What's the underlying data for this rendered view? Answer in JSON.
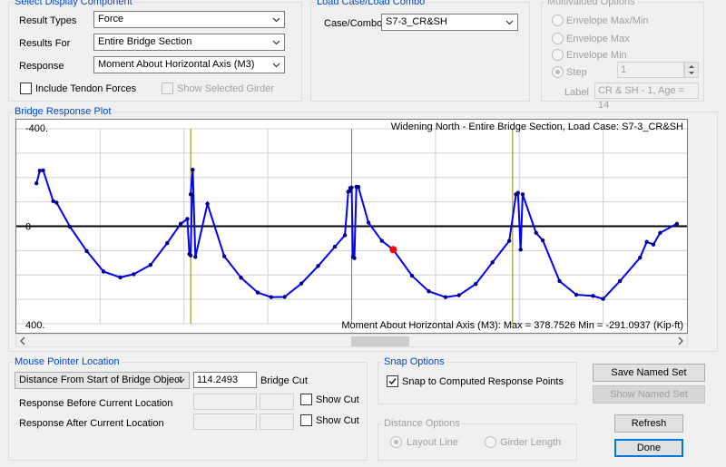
{
  "display": {
    "legend": "Select Display Component",
    "result_types_label": "Result Types",
    "result_types_value": "Force",
    "results_for_label": "Results For",
    "results_for_value": "Entire Bridge Section",
    "response_label": "Response",
    "response_value": "Moment About Horizontal Axis  (M3)",
    "include_tendon_label": "Include Tendon Forces",
    "show_selected_girder_label": "Show Selected Girder"
  },
  "load_case": {
    "legend": "Load Case/Load Combo",
    "case_label": "Case/Combo",
    "case_value": "S7-3_CR&SH"
  },
  "multivalued": {
    "legend": "Multivalued Options",
    "envelope_maxmin": "Envelope Max/Min",
    "envelope_max": "Envelope Max",
    "envelope_min": "Envelope Min",
    "step_label": "Step",
    "step_value": "1",
    "label_label": "Label",
    "label_value": "CR & SH  - 1, Age = 14"
  },
  "plot": {
    "legend": "Bridge Response Plot",
    "header_text": "Widening North - Entire Bridge Section,  Load Case: S7-3_CR&SH",
    "footer_text": "Moment About Horizontal Axis  (M3):  Max = 378.7526    Min = -291.0937  (Kip-ft)"
  },
  "chart_data": {
    "type": "line",
    "y_top_label": "-400.",
    "y_zero_label": "0",
    "y_bottom_label": "400.",
    "ylim": [
      -400,
      400
    ],
    "y_inverted": true,
    "grid": true,
    "line_color": "#0000ff",
    "marker_color": "#00008b",
    "zero_line_color": "#000000",
    "support_line_color": "#8b8b00",
    "cursor_color": "#ff0000",
    "supports_x_fraction": [
      0.26,
      0.5,
      0.74
    ],
    "cursor_point": {
      "x": 0.562,
      "y": 96
    },
    "series": [
      {
        "values": [
          [
            0.03,
            -176
          ],
          [
            0.035,
            -228
          ],
          [
            0.04,
            -229
          ],
          [
            0.055,
            -103
          ],
          [
            0.06,
            -97
          ],
          [
            0.08,
            2
          ],
          [
            0.105,
            102
          ],
          [
            0.13,
            186
          ],
          [
            0.155,
            210
          ],
          [
            0.175,
            197
          ],
          [
            0.2,
            159
          ],
          [
            0.225,
            69
          ],
          [
            0.245,
            -10
          ],
          [
            0.255,
            -30
          ],
          [
            0.258,
            114
          ],
          [
            0.26,
            120
          ],
          [
            0.262,
            -130
          ],
          [
            0.26,
            -131
          ],
          [
            0.263,
            -232
          ],
          [
            0.267,
            126
          ],
          [
            0.285,
            -92
          ],
          [
            0.31,
            123
          ],
          [
            0.335,
            211
          ],
          [
            0.36,
            272
          ],
          [
            0.38,
            291
          ],
          [
            0.4,
            290
          ],
          [
            0.425,
            235
          ],
          [
            0.45,
            163
          ],
          [
            0.475,
            84
          ],
          [
            0.49,
            37
          ],
          [
            0.495,
            -142
          ],
          [
            0.497,
            -145
          ],
          [
            0.498,
            -157
          ],
          [
            0.5,
            -159
          ],
          [
            0.502,
            126
          ],
          [
            0.504,
            131
          ],
          [
            0.507,
            -162
          ],
          [
            0.51,
            -161
          ],
          [
            0.525,
            -15
          ],
          [
            0.545,
            60
          ],
          [
            0.562,
            96
          ],
          [
            0.59,
            203
          ],
          [
            0.615,
            267
          ],
          [
            0.64,
            291
          ],
          [
            0.66,
            283
          ],
          [
            0.685,
            237
          ],
          [
            0.71,
            148
          ],
          [
            0.735,
            60
          ],
          [
            0.745,
            -131
          ],
          [
            0.748,
            -137
          ],
          [
            0.752,
            96
          ],
          [
            0.755,
            -131
          ],
          [
            0.775,
            27
          ],
          [
            0.785,
            58
          ],
          [
            0.81,
            225
          ],
          [
            0.835,
            281
          ],
          [
            0.86,
            286
          ],
          [
            0.875,
            298
          ],
          [
            0.9,
            225
          ],
          [
            0.93,
            129
          ],
          [
            0.94,
            64
          ],
          [
            0.95,
            75
          ],
          [
            0.96,
            27
          ],
          [
            0.985,
            -10
          ]
        ]
      }
    ]
  },
  "mouse": {
    "legend": "Mouse Pointer Location",
    "distance_combo": "Distance From Start of Bridge Object",
    "distance_value": "114.2493",
    "bridge_cut_label": "Bridge Cut",
    "response_before_label": "Response Before Current Location",
    "response_after_label": "Response After Current Location",
    "show_cut_label_1": "Show Cut",
    "show_cut_label_2": "Show Cut"
  },
  "snap": {
    "legend": "Snap Options",
    "snap_label": "Snap to Computed Response Points"
  },
  "distance_options": {
    "legend": "Distance Options",
    "layout_line": "Layout Line",
    "girder_length": "Girder Length"
  },
  "buttons": {
    "save_named_set": "Save Named Set",
    "show_named_set": "Show Named Set",
    "refresh": "Refresh",
    "done": "Done"
  }
}
